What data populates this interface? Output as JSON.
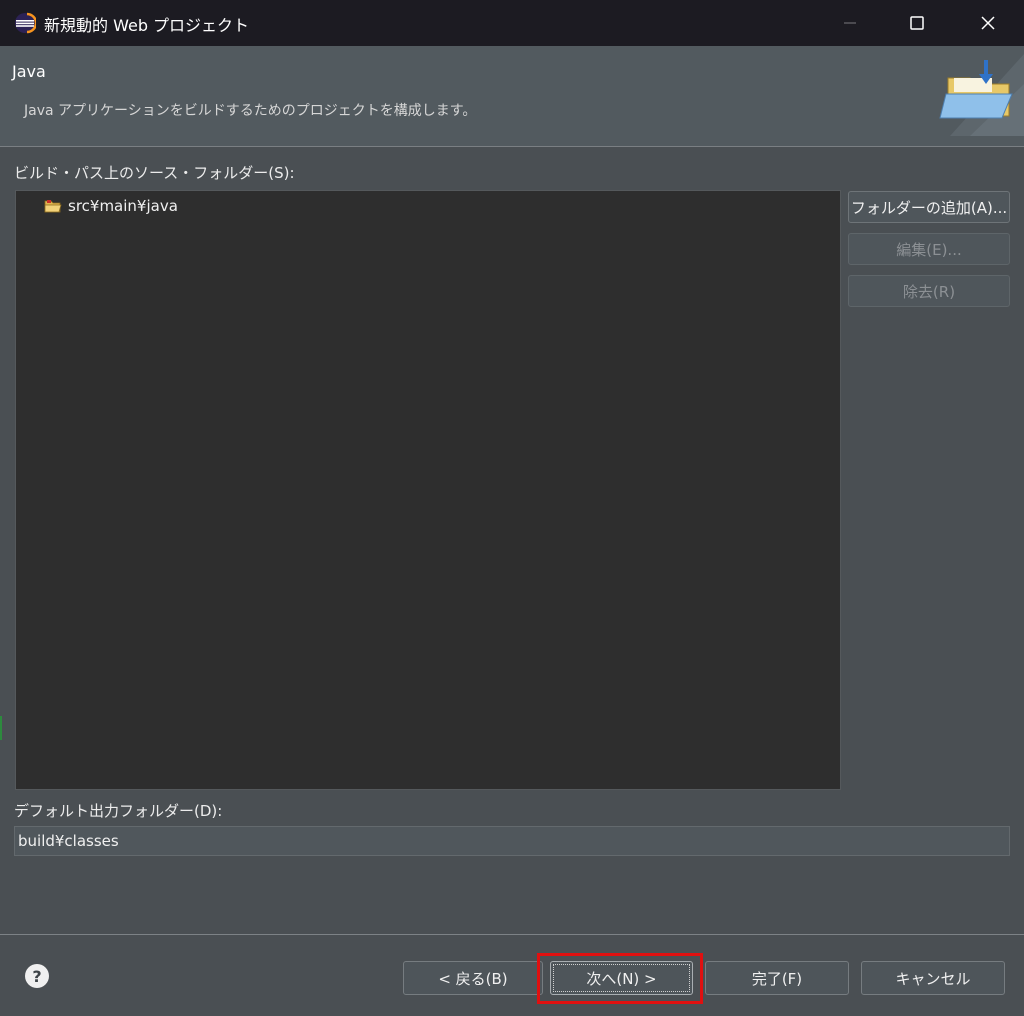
{
  "window": {
    "title": "新規動的 Web プロジェクト",
    "min_icon": "minimize-icon",
    "max_icon": "maximize-icon",
    "close_icon": "close-icon"
  },
  "header": {
    "title": "Java",
    "description": "Java アプリケーションをビルドするためのプロジェクトを構成します。"
  },
  "source_folders": {
    "label": "ビルド・パス上のソース・フォルダー(S):",
    "items": [
      {
        "label": "src¥main¥java",
        "icon": "source-folder-icon"
      }
    ]
  },
  "side_buttons": {
    "add_folder": "フォルダーの追加(A)...",
    "edit": "編集(E)...",
    "remove": "除去(R)"
  },
  "output": {
    "label": "デフォルト出力フォルダー(D):",
    "value": "build¥classes"
  },
  "footer": {
    "help": "?",
    "back": "< 戻る(B)",
    "next": "次へ(N) >",
    "finish": "完了(F)",
    "cancel": "キャンセル"
  },
  "colors": {
    "highlight": "#e01010",
    "background": "#4a4f53",
    "tree_background": "#2e2e2e"
  }
}
